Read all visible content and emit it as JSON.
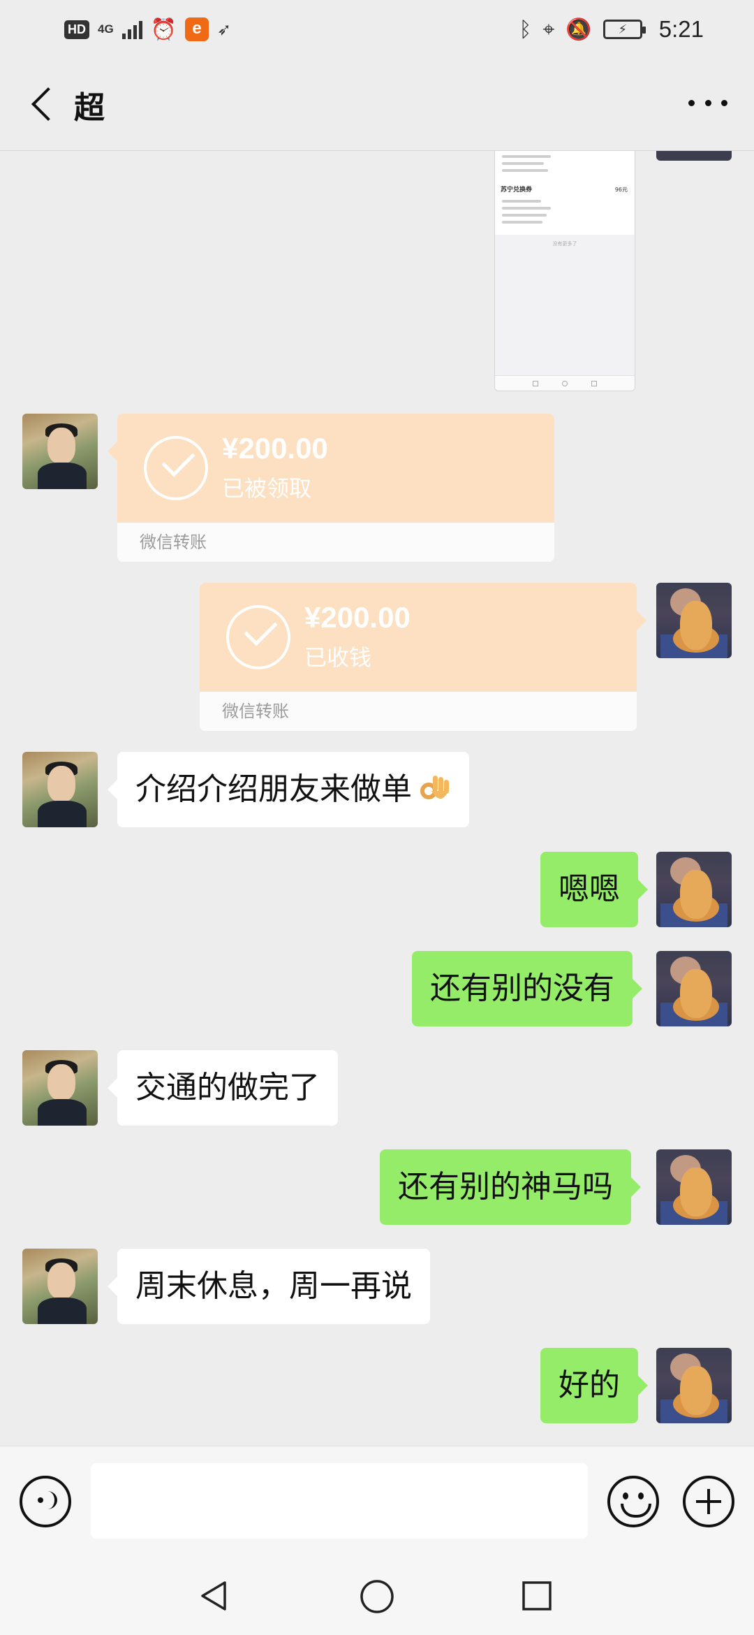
{
  "status_bar": {
    "hd": "HD",
    "network": "4G",
    "time": "5:21"
  },
  "header": {
    "title": "超"
  },
  "shared_image": {
    "item_name": "苏宁兑换券",
    "item_price": "96元",
    "no_more": "没有更多了"
  },
  "messages": [
    {
      "type": "transfer",
      "side": "left",
      "amount": "¥200.00",
      "state": "已被领取",
      "footer": "微信转账"
    },
    {
      "type": "transfer",
      "side": "right",
      "amount": "¥200.00",
      "state": "已收钱",
      "footer": "微信转账"
    },
    {
      "type": "text",
      "side": "left",
      "text": "介绍介绍朋友来做单",
      "emoji": "ok-hand-icon"
    },
    {
      "type": "text",
      "side": "right",
      "text": "嗯嗯"
    },
    {
      "type": "text",
      "side": "right",
      "text": "还有别的没有"
    },
    {
      "type": "text",
      "side": "left",
      "text": "交通的做完了"
    },
    {
      "type": "text",
      "side": "right",
      "text": "还有别的神马吗"
    },
    {
      "type": "text",
      "side": "left",
      "text": "周末休息，周一再说"
    },
    {
      "type": "text",
      "side": "right",
      "text": "好的"
    }
  ],
  "input": {
    "value": ""
  },
  "colors": {
    "background": "#ededed",
    "bubble_mine": "#95ec69",
    "bubble_theirs": "#ffffff",
    "transfer": "#fce0c1"
  }
}
